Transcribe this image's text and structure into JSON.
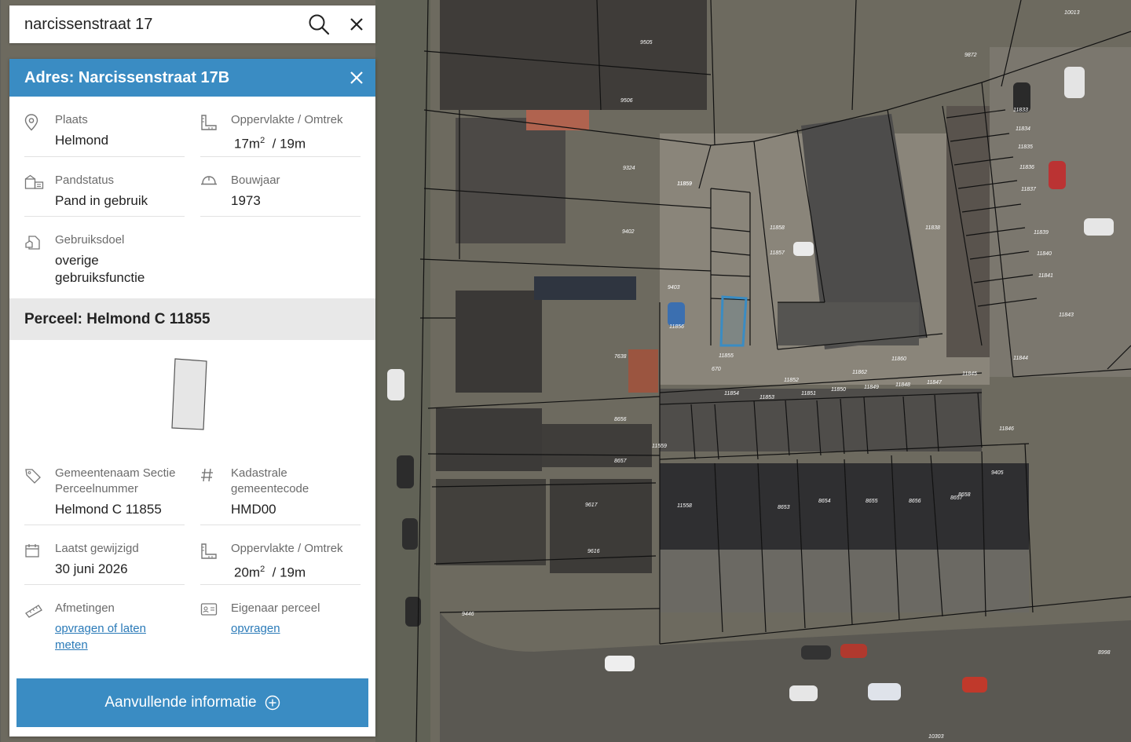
{
  "search": {
    "value": "narcissenstraat 17"
  },
  "address_panel": {
    "title": "Adres: Narcissenstraat 17B",
    "fields": [
      {
        "label": "Plaats",
        "value": "Helmond"
      },
      {
        "label": "Oppervlakte / Omtrek",
        "area": "17m",
        "area_unit_sup": "2",
        "perimeter": "/ 19m"
      },
      {
        "label": "Pandstatus",
        "value": "Pand in gebruik"
      },
      {
        "label": "Bouwjaar",
        "value": "1973"
      },
      {
        "label": "Gebruiksdoel",
        "value_line1": "overige",
        "value_line2": "gebruiksfunctie"
      }
    ]
  },
  "parcel_section": {
    "title": "Perceel: Helmond C 11855",
    "fields": [
      {
        "label_line1": "Gemeentenaam Sectie",
        "label_line2": "Perceelnummer",
        "value": "Helmond C 11855"
      },
      {
        "label_line1": "Kadastrale",
        "label_line2": "gemeentecode",
        "value": "HMD00"
      },
      {
        "label": "Laatst gewijzigd",
        "value": "30 juni 2026"
      },
      {
        "label": "Oppervlakte / Omtrek",
        "area": "20m",
        "area_unit_sup": "2",
        "perimeter": "/ 19m"
      },
      {
        "label": "Afmetingen",
        "link_line1": "opvragen of laten",
        "link_line2": "meten"
      },
      {
        "label": "Eigenaar perceel",
        "link": "opvragen"
      }
    ]
  },
  "cta": {
    "label": "Aanvullende informatie"
  },
  "map": {
    "parcel_labels": [
      "10013",
      "9872",
      "9505",
      "9506",
      "9324",
      "9402",
      "9403",
      "11856",
      "11859",
      "11858",
      "11857",
      "11855",
      "670",
      "7638",
      "8656",
      "8657",
      "9617",
      "9616",
      "9446",
      "11558",
      "11859",
      "11860",
      "11862",
      "11852",
      "11850",
      "11849",
      "11848",
      "11847",
      "11845",
      "11846",
      "11854",
      "11853",
      "11851",
      "11833",
      "11834",
      "11835",
      "11836",
      "11837",
      "11838",
      "11839",
      "11840",
      "11841",
      "11843",
      "11844",
      "9405",
      "8998",
      "10303",
      "8654",
      "8653",
      "8655",
      "8656",
      "8657",
      "8658",
      "11559"
    ],
    "highlight_color": "#3a8cc3"
  },
  "colors": {
    "accent": "#3a8cc3",
    "section_bg": "#e8e8e8"
  },
  "icons": [
    "search-icon",
    "close-icon",
    "location-pin-icon",
    "ruler-area-icon",
    "building-status-icon",
    "helmet-icon",
    "usage-icon",
    "tag-icon",
    "hash-icon",
    "calendar-icon",
    "measure-tape-icon",
    "id-card-icon",
    "plus-circle-icon"
  ]
}
